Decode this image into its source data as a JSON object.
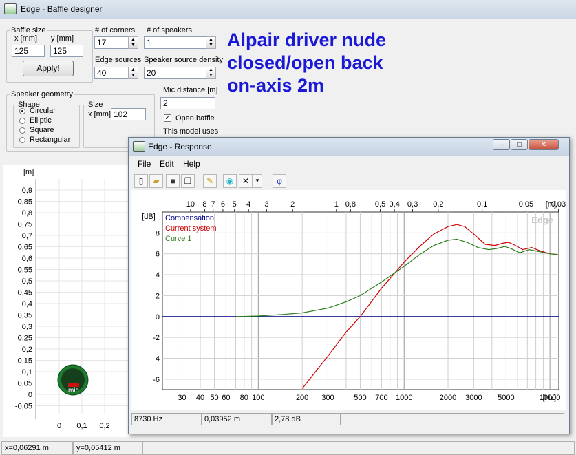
{
  "main_window": {
    "title": "Edge - Baffle designer",
    "baffle_size": {
      "legend": "Baffle size",
      "x_label": "x [mm]",
      "y_label": "y [mm]",
      "x_value": "125",
      "y_value": "125",
      "apply_label": "Apply!"
    },
    "corners": {
      "label": "# of corners",
      "value": "17"
    },
    "speakers": {
      "label": "# of speakers",
      "value": "1"
    },
    "edge_sources": {
      "label": "Edge sources",
      "value": "40"
    },
    "source_density": {
      "label": "Speaker source density",
      "value": "20"
    },
    "geometry": {
      "legend": "Speaker geometry",
      "shape_legend": "Shape",
      "shapes": [
        "Circular",
        "Elliptic",
        "Square",
        "Rectangular"
      ],
      "selected_shape": "Circular",
      "size_legend": "Size",
      "size_label": "x [mm]",
      "size_value": "102"
    },
    "mic": {
      "label": "Mic distance [m]",
      "value": "2",
      "open_baffle_label": "Open baffle",
      "open_baffle_checked": true,
      "model_text": "This model uses"
    },
    "note": [
      "Alpair driver nude",
      "closed/open back",
      "on-axis 2m"
    ],
    "plot": {
      "unit": "[m]",
      "y_ticks": [
        "0,9",
        "0,85",
        "0,8",
        "0,75",
        "0,7",
        "0,65",
        "0,6",
        "0,55",
        "0,5",
        "0,45",
        "0,4",
        "0,35",
        "0,3",
        "0,25",
        "0,2",
        "0,15",
        "0,1",
        "0,05",
        "0",
        "-0,05"
      ],
      "x_ticks": [
        "0",
        "0,1",
        "0,2"
      ],
      "mic_label": "mic"
    },
    "status": {
      "x": "x=0,06291 m",
      "y": "y=0,05412 m"
    }
  },
  "response_window": {
    "title": "Edge - Response",
    "menu": [
      "File",
      "Edit",
      "Help"
    ],
    "toolbar": [
      "new-icon",
      "open-icon",
      "save-icon",
      "copy-icon",
      "pencil-icon",
      "speaker-icon",
      "delete-icon",
      "dropdown-icon",
      "phase-icon"
    ],
    "phi_glyph": "φ",
    "chart_data": {
      "type": "line",
      "title": "",
      "xlabel": "[Hz]",
      "ylabel": "[dB]",
      "x_scale": "log",
      "xlim": [
        22,
        11500
      ],
      "ylim": [
        -7,
        10
      ],
      "x_ticks": [
        30,
        40,
        50,
        60,
        80,
        100,
        200,
        300,
        500,
        700,
        1000,
        2000,
        3000,
        5000,
        10000
      ],
      "x_tick_labels": [
        "30",
        "40",
        "50",
        "60",
        "80",
        "100",
        "200",
        "300",
        "500",
        "700",
        "1000",
        "2000",
        "3000",
        "5000",
        "10000"
      ],
      "y_ticks": [
        8,
        6,
        4,
        2,
        0,
        -2,
        -4,
        -6
      ],
      "top_axis_unit": "[m]",
      "top_axis_labels": [
        {
          "f": 34.3,
          "label": "10"
        },
        {
          "f": 42.9,
          "label": "8"
        },
        {
          "f": 49,
          "label": "7"
        },
        {
          "f": 57.2,
          "label": "6"
        },
        {
          "f": 68.6,
          "label": "5"
        },
        {
          "f": 85.8,
          "label": "4"
        },
        {
          "f": 114,
          "label": "3"
        },
        {
          "f": 172,
          "label": "2"
        },
        {
          "f": 343,
          "label": "1"
        },
        {
          "f": 429,
          "label": "0,8"
        },
        {
          "f": 686,
          "label": "0,5"
        },
        {
          "f": 858,
          "label": "0,4"
        },
        {
          "f": 1143,
          "label": "0,3"
        },
        {
          "f": 1715,
          "label": "0,2"
        },
        {
          "f": 3430,
          "label": "0,1"
        },
        {
          "f": 6860,
          "label": "0,05"
        },
        {
          "f": 11433,
          "label": "0,03"
        }
      ],
      "watermark": "Edge",
      "legend_position": "top-left",
      "series": [
        {
          "name": "Compensation",
          "color": "#00008b",
          "points": [
            [
              22,
              0
            ],
            [
              11500,
              0
            ]
          ]
        },
        {
          "name": "Current system",
          "color": "#cc0000",
          "points": [
            [
              200,
              -6.9
            ],
            [
              300,
              -3.8
            ],
            [
              400,
              -1.5
            ],
            [
              500,
              0
            ],
            [
              700,
              2.7
            ],
            [
              1000,
              5.2
            ],
            [
              1300,
              6.8
            ],
            [
              1600,
              7.9
            ],
            [
              2000,
              8.6
            ],
            [
              2300,
              8.8
            ],
            [
              2600,
              8.6
            ],
            [
              3000,
              7.9
            ],
            [
              3600,
              6.9
            ],
            [
              4200,
              6.8
            ],
            [
              4700,
              7.0
            ],
            [
              5200,
              7.1
            ],
            [
              5800,
              6.8
            ],
            [
              6500,
              6.4
            ],
            [
              7500,
              6.6
            ],
            [
              8500,
              6.3
            ],
            [
              10000,
              6.0
            ],
            [
              11500,
              5.9
            ]
          ]
        },
        {
          "name": "Curve 1",
          "color": "#2e7d1e",
          "points": [
            [
              70,
              0
            ],
            [
              100,
              0.05
            ],
            [
              150,
              0.2
            ],
            [
              200,
              0.35
            ],
            [
              300,
              0.8
            ],
            [
              400,
              1.4
            ],
            [
              500,
              2.0
            ],
            [
              700,
              3.3
            ],
            [
              1000,
              4.8
            ],
            [
              1300,
              6.0
            ],
            [
              1600,
              6.8
            ],
            [
              2000,
              7.3
            ],
            [
              2300,
              7.4
            ],
            [
              2700,
              7.1
            ],
            [
              3200,
              6.6
            ],
            [
              3800,
              6.4
            ],
            [
              4300,
              6.5
            ],
            [
              4900,
              6.7
            ],
            [
              5400,
              6.5
            ],
            [
              6200,
              6.1
            ],
            [
              7200,
              6.4
            ],
            [
              8500,
              6.2
            ],
            [
              10000,
              6.0
            ],
            [
              11500,
              5.9
            ]
          ]
        }
      ]
    },
    "status": {
      "freq": "8730 Hz",
      "dist": "0,03952 m",
      "level": "2,78 dB"
    }
  }
}
